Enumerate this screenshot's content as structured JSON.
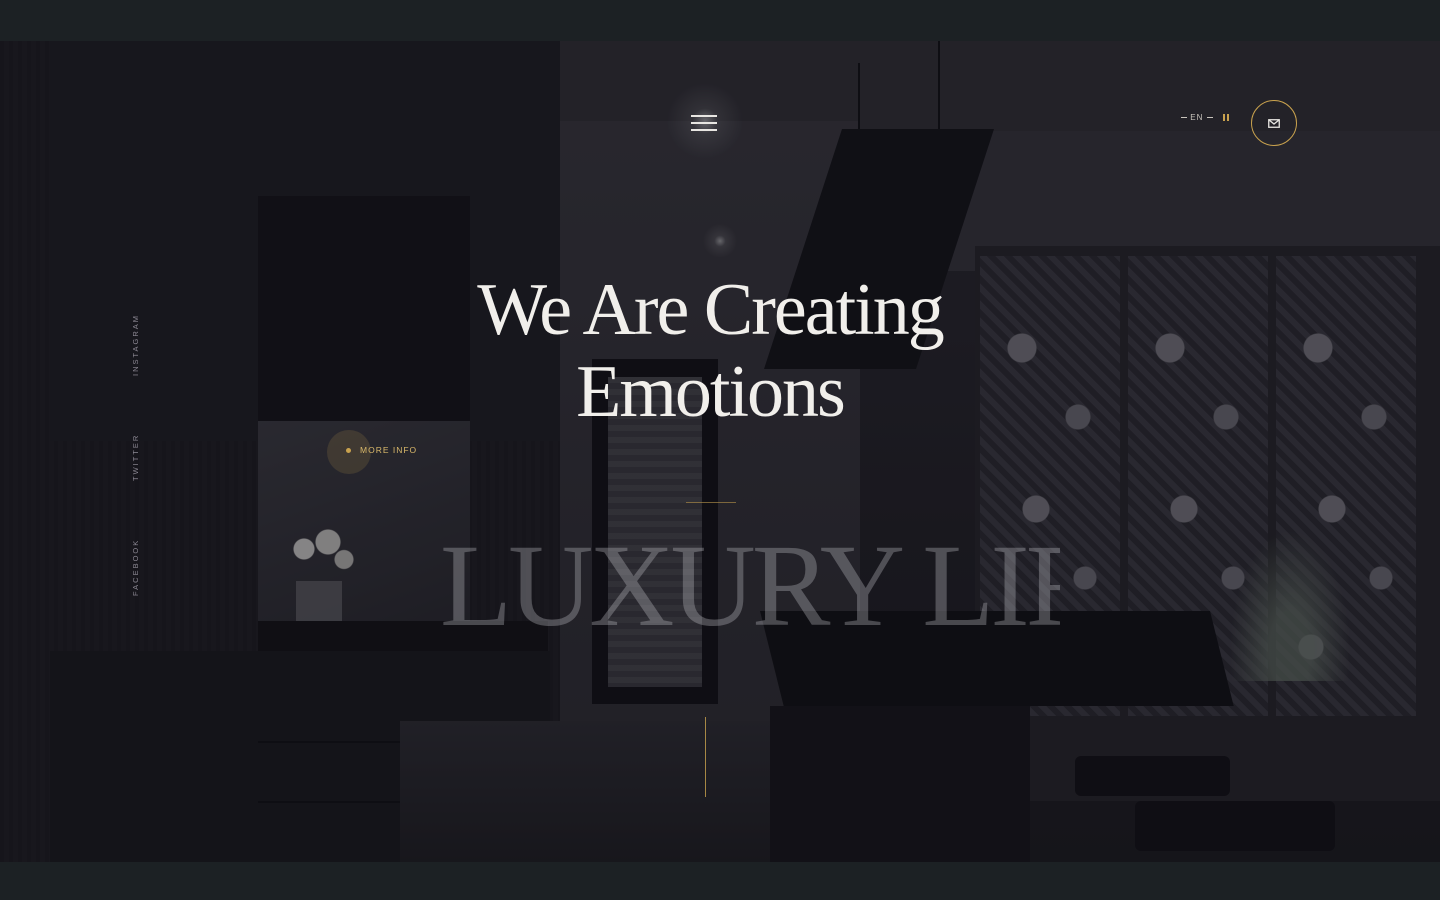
{
  "hero": {
    "headline_line1": "We Are Creating",
    "headline_line2": "Emotions",
    "more_info_label": "MORE INFO",
    "background_word": "LUXURY LIFE"
  },
  "header": {
    "menu_icon": "hamburger-icon",
    "language": "EN",
    "mail_icon": "mail-icon",
    "pause_icon": "pause-icon"
  },
  "social": {
    "links": [
      "INSTAGRAM",
      "TWITTER",
      "FACEBOOK"
    ]
  },
  "colors": {
    "accent": "#c9a24e",
    "text": "#f1efeb",
    "frame": "#1c2124"
  }
}
